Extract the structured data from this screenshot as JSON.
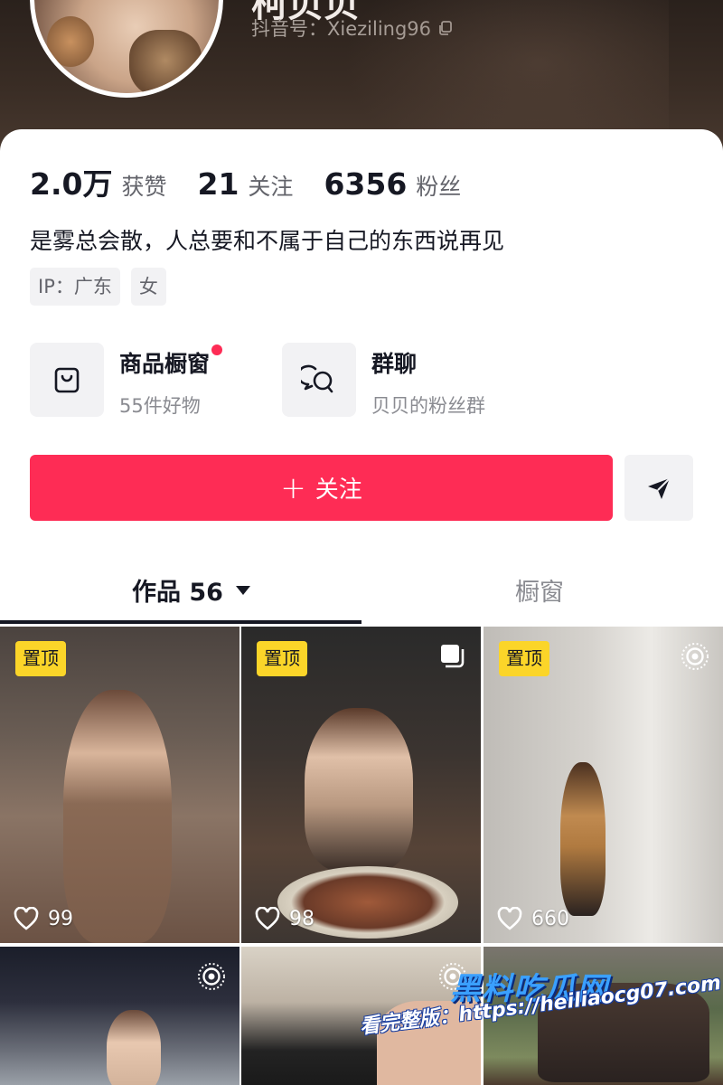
{
  "profile": {
    "name_partial": "柯贝贝",
    "handle": "抖音号：Xieziling96"
  },
  "stats": [
    {
      "num": "2.0万",
      "label": "获赞"
    },
    {
      "num": "21",
      "label": "关注"
    },
    {
      "num": "6356",
      "label": "粉丝"
    }
  ],
  "bio": "是雾总会散，人总要和不属于自己的东西说再见",
  "tags": [
    "IP：广东",
    "女"
  ],
  "features": {
    "shop": {
      "title": "商品橱窗",
      "subtitle": "55件好物",
      "icon": "shopping-bag-icon"
    },
    "group": {
      "title": "群聊",
      "subtitle": "贝贝的粉丝群",
      "icon": "chat-bubbles-icon"
    }
  },
  "actions": {
    "follow_label": "关注",
    "share_icon": "send-icon"
  },
  "tabs": {
    "works": "作品 56",
    "window": "橱窗"
  },
  "grid": [
    {
      "pinned": "置顶",
      "likes": "99",
      "corner_icon": ""
    },
    {
      "pinned": "置顶",
      "likes": "98",
      "corner_icon": "multi-image-icon"
    },
    {
      "pinned": "置顶",
      "likes": "660",
      "corner_icon": "live-photo-icon"
    },
    {
      "pinned": "",
      "likes": "",
      "corner_icon": "live-photo-icon"
    },
    {
      "pinned": "",
      "likes": "",
      "corner_icon": "live-photo-icon"
    },
    {
      "pinned": "",
      "likes": "",
      "corner_icon": ""
    }
  ],
  "watermark": {
    "title": "黑料吃瓜网",
    "url_line": "看完整版：https://heiliaocg07.com"
  },
  "colors": {
    "brand_red": "#fe2c55",
    "pin_yellow": "#fbd529",
    "text_primary": "#161823",
    "text_secondary": "#8a8b91"
  }
}
